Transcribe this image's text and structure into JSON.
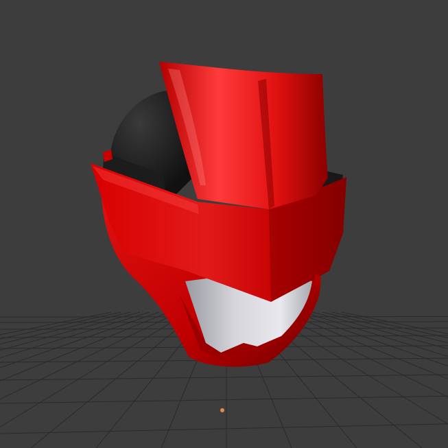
{
  "viewport": {
    "background_color": "#3d3d3d",
    "grid_color": "#2a2a2a",
    "origin_marker_color": "#e08a4a"
  },
  "model": {
    "shell_color": "#cc0000",
    "shell_highlight_color": "#ff3a3a",
    "shell_shadow_color": "#7a0000",
    "dome_color": "#1f1f1f",
    "visor_color": "#c8c8cf"
  }
}
